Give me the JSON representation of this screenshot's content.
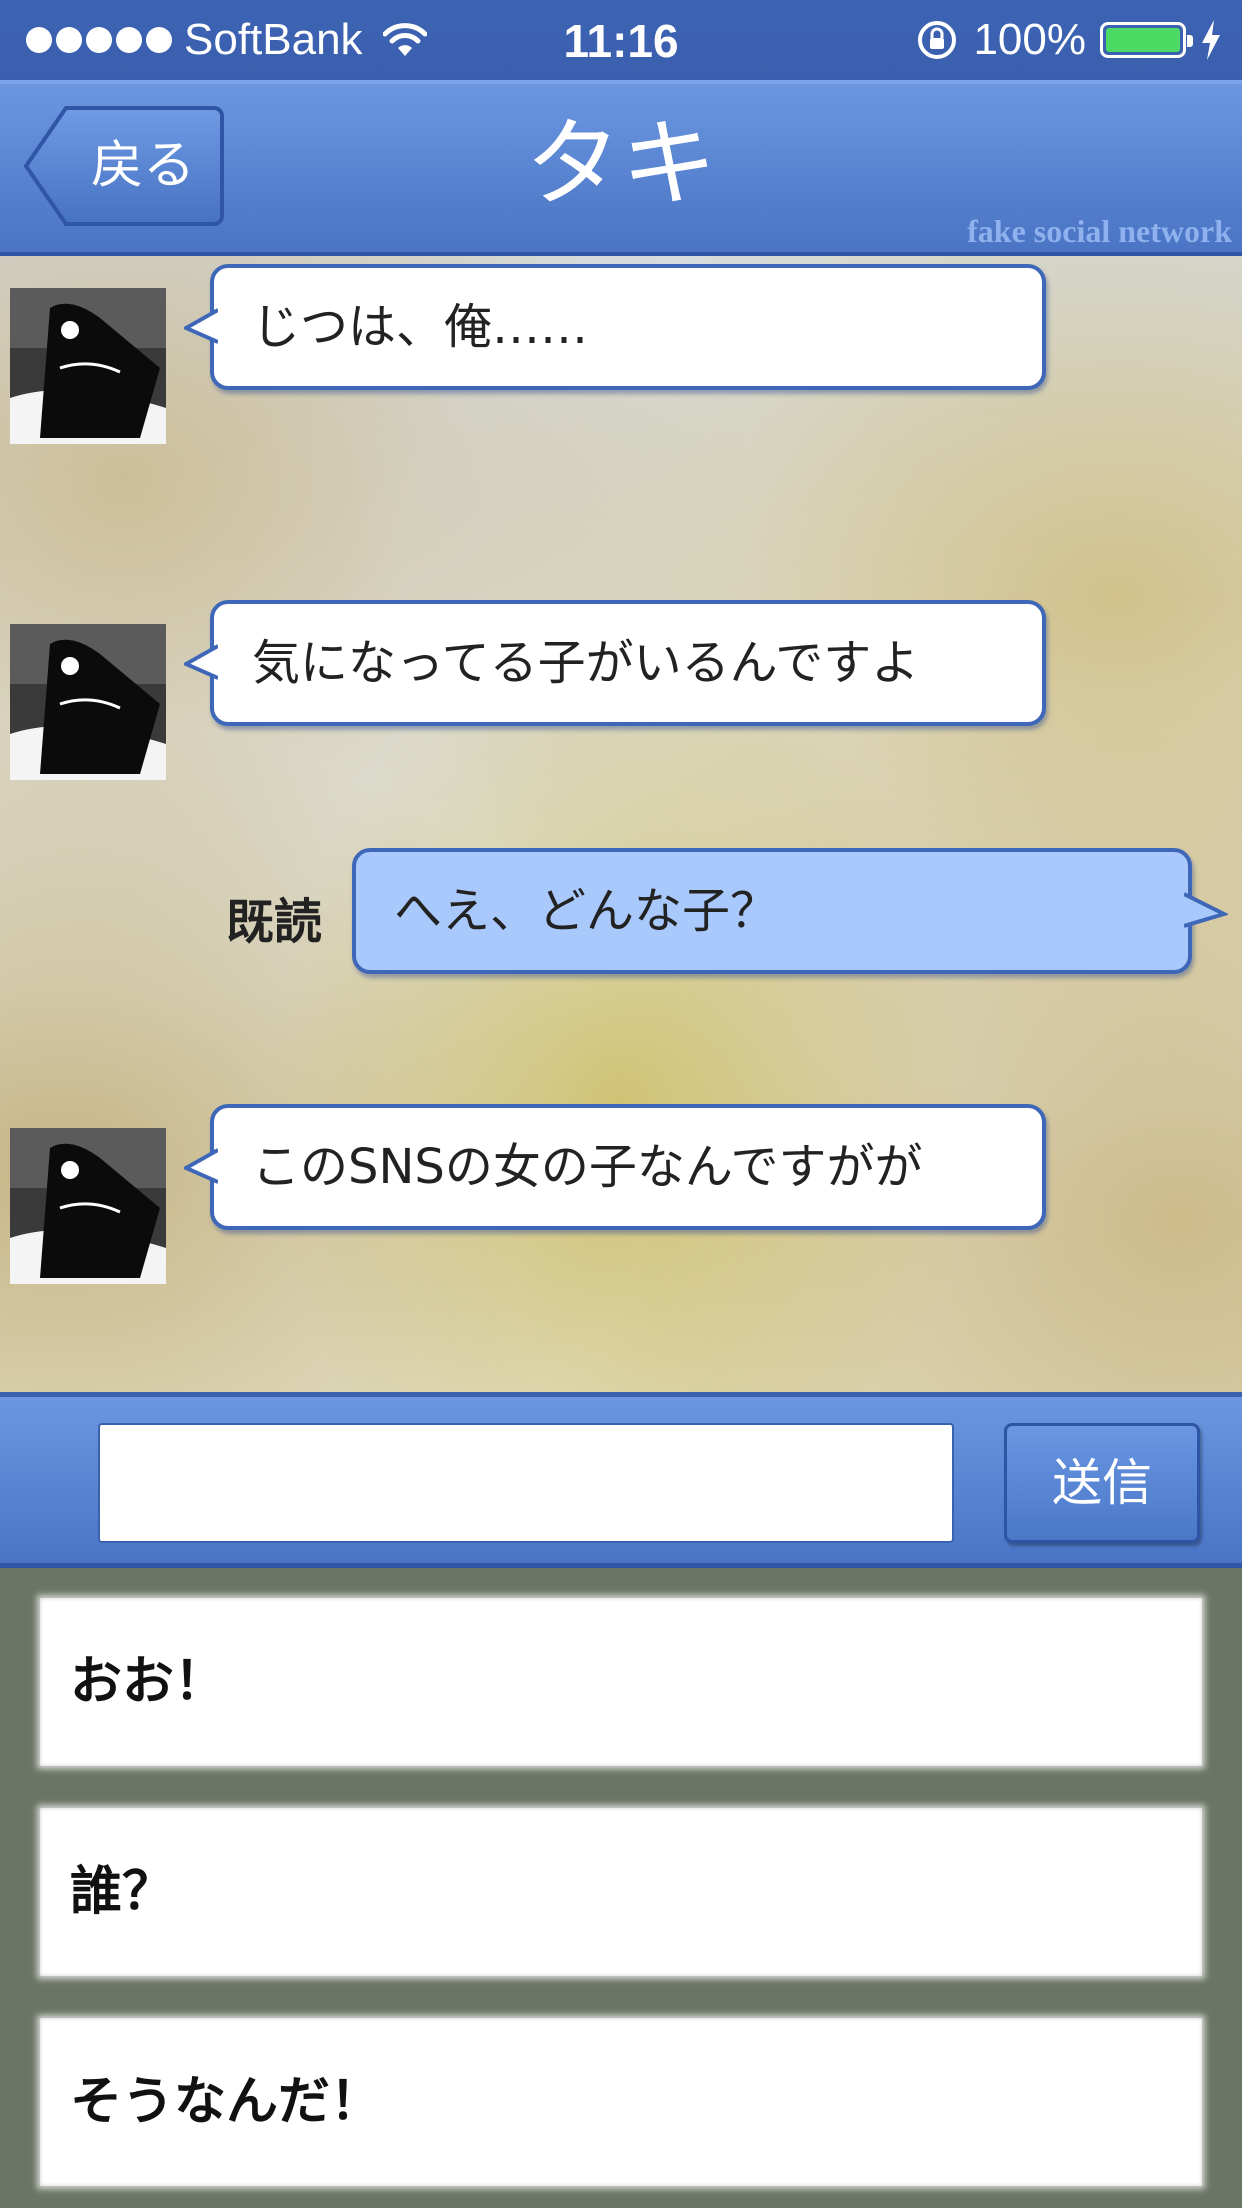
{
  "status_bar": {
    "carrier": "SoftBank",
    "time": "11:16",
    "battery_percent": "100%",
    "battery_level": 1.0
  },
  "nav": {
    "back_label": "戻る",
    "title": "タキ",
    "watermark": "fake social network"
  },
  "messages": [
    {
      "from": "them",
      "text": "じつは、俺……"
    },
    {
      "from": "them",
      "text": "気になってる子がいるんですよ"
    },
    {
      "from": "me",
      "text": "へえ、どんな子？",
      "read_label": "既読"
    },
    {
      "from": "them",
      "text": "このSNSの女の子なんですがが"
    }
  ],
  "input": {
    "value": "",
    "placeholder": "",
    "send_label": "送信"
  },
  "reply_options": [
    "おお！",
    "誰？",
    "そうなんだ！"
  ],
  "colors": {
    "nav_blue": "#5a85d2",
    "sent_bubble": "#a9c8fb",
    "options_bg": "#6b7565",
    "battery_green": "#4cd964"
  }
}
